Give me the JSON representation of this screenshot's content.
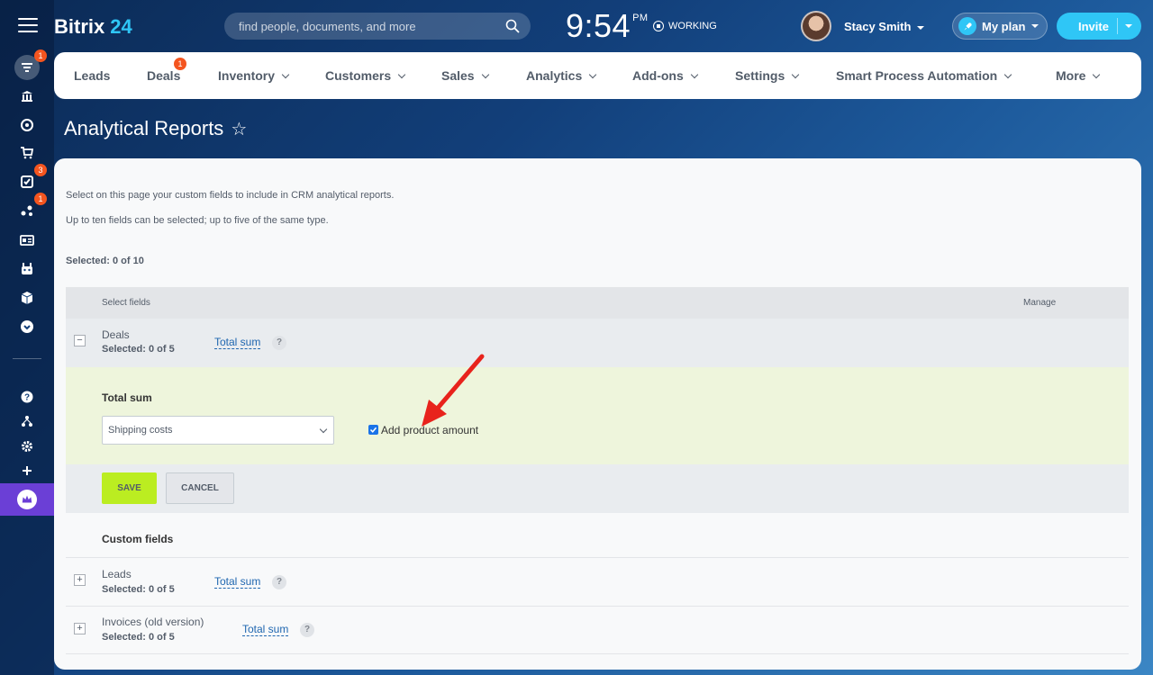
{
  "app": {
    "logo_text": "Bitrix",
    "logo_num": "24",
    "search_placeholder": "find people, documents, and more",
    "clock_time": "9:54",
    "clock_ampm": "PM",
    "working_label": "WORKING",
    "user_name": "Stacy Smith",
    "myplan_label": "My plan",
    "invite_label": "Invite"
  },
  "rail_badges": {
    "feed": "1",
    "tasks": "3",
    "crm": "1"
  },
  "topnav": {
    "items": [
      {
        "label": "Leads"
      },
      {
        "label": "Deals",
        "badge": "1"
      },
      {
        "label": "Inventory"
      },
      {
        "label": "Customers"
      },
      {
        "label": "Sales"
      },
      {
        "label": "Analytics"
      },
      {
        "label": "Add-ons"
      },
      {
        "label": "Settings"
      },
      {
        "label": "Smart Process Automation"
      },
      {
        "label": "More"
      }
    ]
  },
  "page": {
    "title": "Analytical Reports",
    "intro1": "Select on this page your custom fields to include in CRM analytical reports.",
    "intro2": "Up to ten fields can be selected; up to five of the same type.",
    "selected_total": "Selected: 0 of 10"
  },
  "table": {
    "col_fields": "Select fields",
    "col_manage": "Manage"
  },
  "groups": {
    "deals": {
      "name": "Deals",
      "count": "Selected: 0 of 5",
      "link": "Total sum"
    },
    "leads": {
      "name": "Leads",
      "count": "Selected: 0 of 5",
      "link": "Total sum"
    },
    "invoices": {
      "name": "Invoices (old version)",
      "count": "Selected: 0 of 5",
      "link": "Total sum"
    }
  },
  "edit": {
    "title": "Total sum",
    "select_value": "Shipping costs",
    "checkbox_label": "Add product amount",
    "checkbox_checked": true,
    "save_label": "SAVE",
    "cancel_label": "CANCEL"
  },
  "custom_fields_title": "Custom fields",
  "colors": {
    "accent": "#2fc6f6",
    "save": "#bbed21",
    "badge": "#f4551f",
    "crown": "#6b3fd6",
    "arrow": "#e8231c"
  }
}
